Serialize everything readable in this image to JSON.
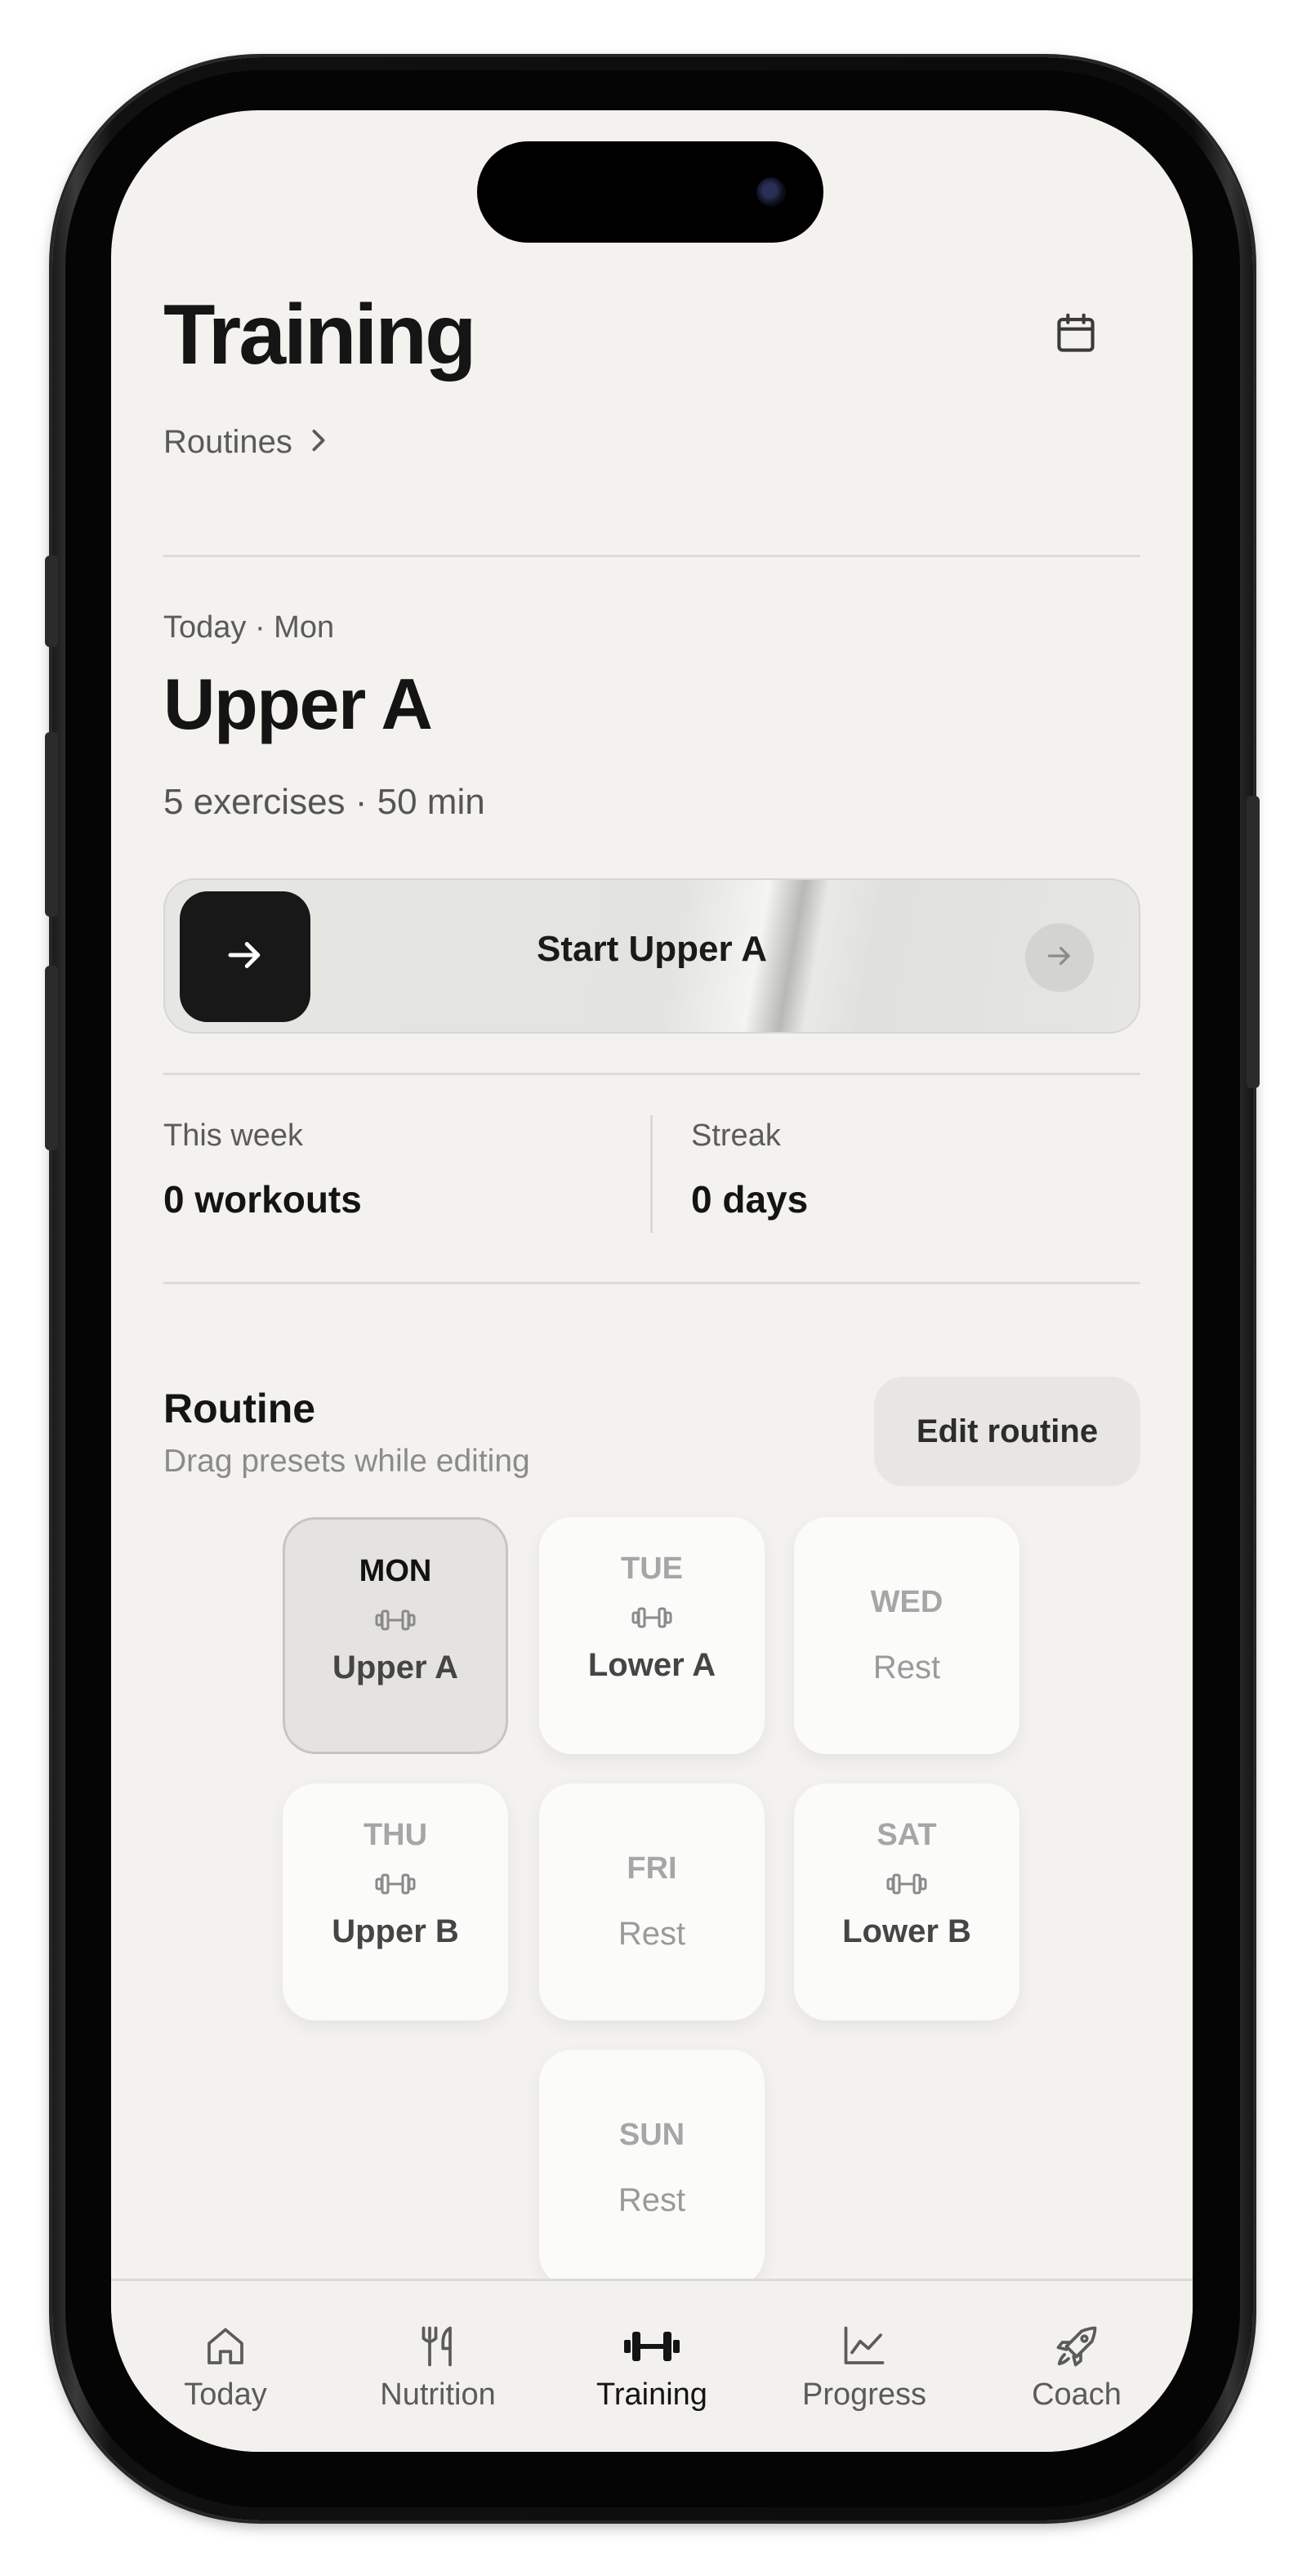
{
  "header": {
    "title": "Training",
    "calendar_icon": "calendar-icon",
    "breadcrumb": "Routines",
    "breadcrumb_icon": "chevron-right-icon"
  },
  "today": {
    "label": "Today · Mon",
    "workout": "Upper A",
    "meta": "5 exercises · 50 min"
  },
  "start": {
    "label": "Start Upper A",
    "knob_icon": "arrow-right-icon",
    "end_icon": "arrow-right-icon"
  },
  "stats": {
    "week_label": "This week",
    "week_value": "0 workouts",
    "streak_label": "Streak",
    "streak_value": "0 days"
  },
  "routine": {
    "title": "Routine",
    "subtitle": "Drag presets while editing",
    "edit_label": "Edit routine",
    "days": [
      {
        "code": "MON",
        "name": "Upper A",
        "icon": "dumbbell-icon",
        "active": true
      },
      {
        "code": "TUE",
        "name": "Lower A",
        "icon": "dumbbell-icon"
      },
      {
        "code": "WED",
        "name": "Rest"
      },
      {
        "code": "THU",
        "name": "Upper B",
        "icon": "dumbbell-icon"
      },
      {
        "code": "FRI",
        "name": "Rest"
      },
      {
        "code": "SAT",
        "name": "Lower B",
        "icon": "dumbbell-icon"
      },
      {
        "code": "SUN",
        "name": "Rest"
      }
    ]
  },
  "tabs": [
    {
      "label": "Today",
      "icon": "home-icon"
    },
    {
      "label": "Nutrition",
      "icon": "fork-knife-icon"
    },
    {
      "label": "Training",
      "icon": "dumbbell-icon",
      "active": true
    },
    {
      "label": "Progress",
      "icon": "chart-icon"
    },
    {
      "label": "Coach",
      "icon": "rocket-icon"
    }
  ],
  "colors": {
    "background": "#f3f2ef",
    "primary_text": "#151515",
    "secondary_text": "#5b5b5b",
    "muted_text": "#a6a6a6",
    "card": "#fbfbf9",
    "active_card": "#e4e3df",
    "button_dark": "#181818"
  }
}
